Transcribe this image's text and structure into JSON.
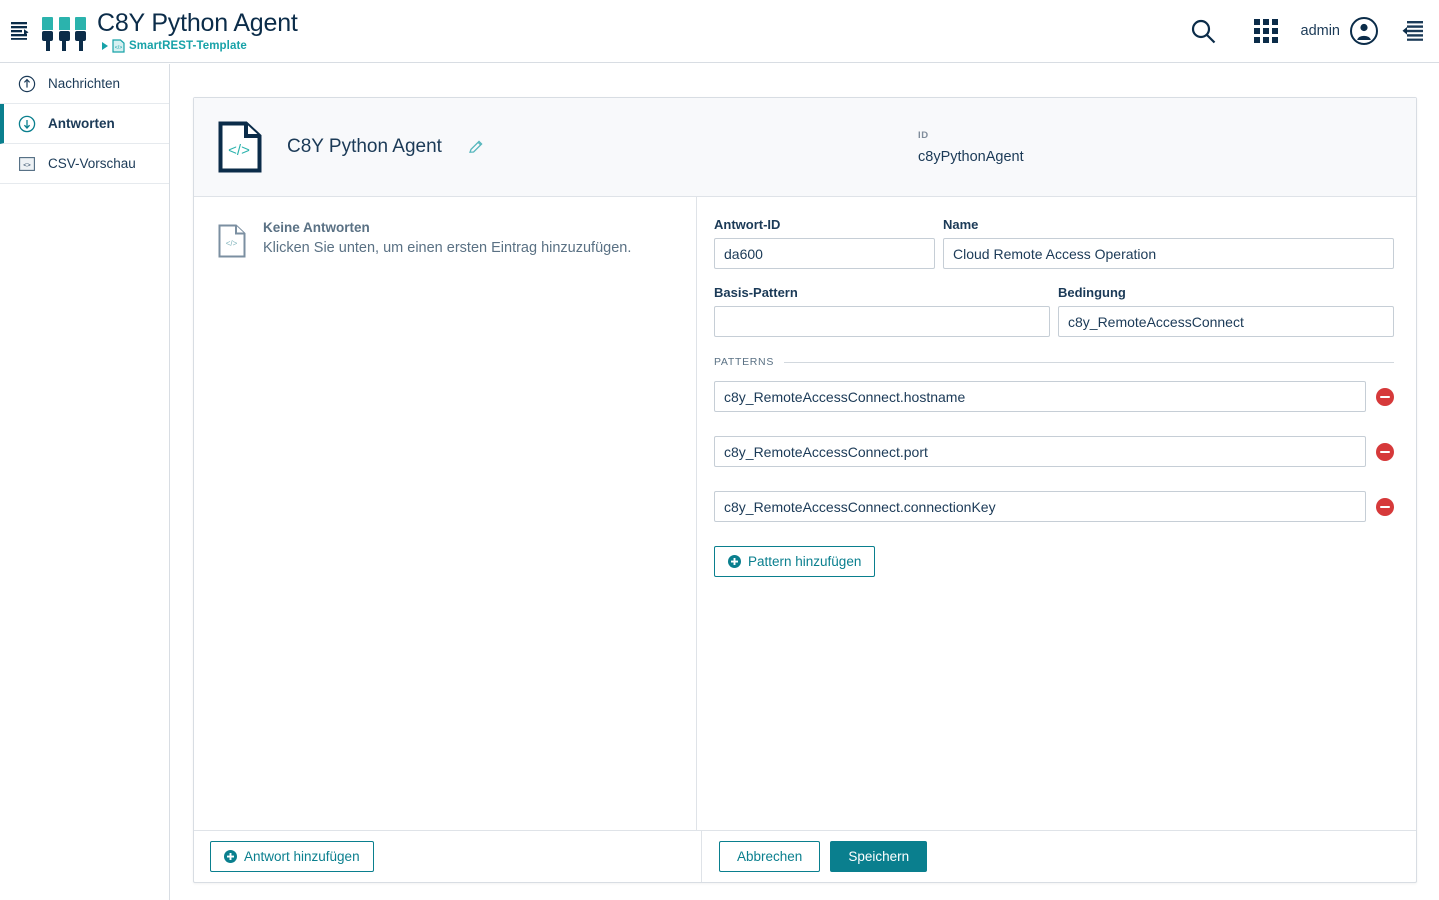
{
  "topbar": {
    "nav_toggle_icon": "sidebar-collapse-icon",
    "logo_icon": "three-plugs-logo",
    "title": "C8Y Python Agent",
    "breadcrumb": {
      "caret_icon": "caret-right-icon",
      "doc_icon": "code-document-icon",
      "label": "SmartREST-Template"
    },
    "search_icon": "search-icon",
    "apps_icon": "app-grid-icon",
    "user_name": "admin",
    "user_avatar_icon": "user-avatar-icon",
    "right_panel_icon": "right-panel-toggle-icon"
  },
  "sidebar": {
    "items": [
      {
        "label": "Nachrichten",
        "icon": "arrow-up-circle-icon",
        "active": false
      },
      {
        "label": "Antworten",
        "icon": "arrow-down-circle-icon",
        "active": true
      },
      {
        "label": "CSV-Vorschau",
        "icon": "code-square-icon",
        "active": false
      }
    ]
  },
  "card": {
    "header": {
      "doc_icon": "code-document-icon",
      "title": "C8Y Python Agent",
      "edit_icon": "pencil-edit-icon",
      "id_label": "ID",
      "id_value": "c8yPythonAgent"
    },
    "empty_state": {
      "icon": "code-document-icon",
      "title": "Keine Antworten",
      "subtitle": "Klicken Sie unten, um einen ersten Eintrag hinzuzufügen."
    },
    "form": {
      "response_id": {
        "label": "Antwort-ID",
        "value": "da600",
        "placeholder": ""
      },
      "name": {
        "label": "Name",
        "value": "Cloud Remote Access Operation",
        "placeholder": ""
      },
      "base_pattern": {
        "label": "Basis-Pattern",
        "value": "",
        "placeholder": ""
      },
      "condition": {
        "label": "Bedingung",
        "value": "c8y_RemoteAccessConnect",
        "placeholder": ""
      },
      "patterns_legend": "PATTERNS",
      "patterns": [
        {
          "value": "c8y_RemoteAccessConnect.hostname",
          "remove_icon": "minus-circle-icon"
        },
        {
          "value": "c8y_RemoteAccessConnect.port",
          "remove_icon": "minus-circle-icon"
        },
        {
          "value": "c8y_RemoteAccessConnect.connectionKey",
          "remove_icon": "minus-circle-icon"
        }
      ],
      "add_pattern_button": {
        "label": "Pattern hinzufügen",
        "icon": "plus-circle-icon"
      }
    },
    "footer": {
      "add_response_button": {
        "label": "Antwort hinzufügen",
        "icon": "plus-circle-icon"
      },
      "cancel_button": "Abbrechen",
      "save_button": "Speichern"
    }
  },
  "colors": {
    "teal": "#0a7f8e",
    "teal_light": "#2bb3ad",
    "navy": "#0b2c49",
    "red": "#d6393a"
  }
}
